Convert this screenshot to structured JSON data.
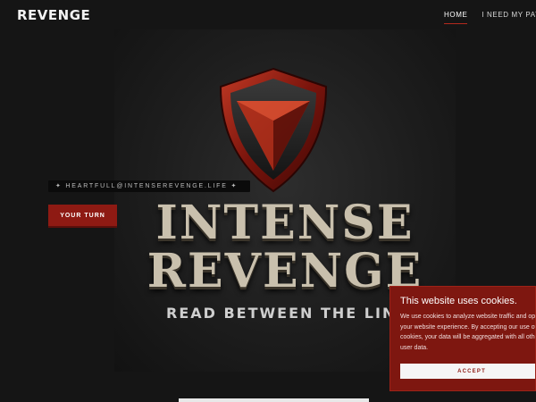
{
  "header": {
    "brand": "REVENGE",
    "nav": [
      {
        "label": "HOME",
        "active": true
      },
      {
        "label": "I NEED MY PAYBACK",
        "active": false
      }
    ]
  },
  "hero": {
    "email": "✦ HEARTFULL@INTENSEREVENGE.LIFE ✦",
    "cta_label": "YOUR TURN",
    "title_line1": "INTENSE",
    "title_line2": "REVENGE",
    "tagline": "READ BETWEEN THE LINES"
  },
  "cookie_banner": {
    "title": "This website uses cookies.",
    "text": "We use cookies to analyze website traffic and optimize your website experience. By accepting our use of cookies, your data will be aggregated with all other user data.",
    "accept_label": "ACCEPT"
  },
  "colors": {
    "accent": "#8e1a13",
    "background": "#151515",
    "title_text": "#c9c0ad"
  },
  "icons": {
    "hero_emblem": "shield-emblem-icon"
  }
}
